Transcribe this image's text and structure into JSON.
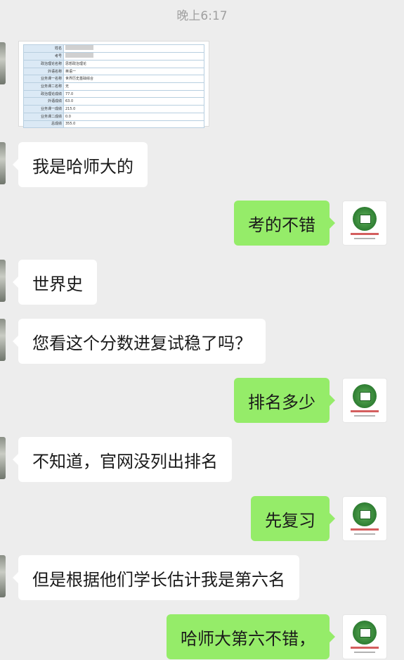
{
  "status": {
    "time": "晚上6:17"
  },
  "score_image": {
    "rows": [
      {
        "label": "姓名",
        "value": ""
      },
      {
        "label": "考号",
        "value": ""
      },
      {
        "label": "政治理论名称",
        "value": "思想政治理论"
      },
      {
        "label": "外语名称",
        "value": "英语一"
      },
      {
        "label": "业务课一名称",
        "value": "世界历史基础综合"
      },
      {
        "label": "业务课二名称",
        "value": "无"
      },
      {
        "label": "政治理论成绩",
        "value": "77.0"
      },
      {
        "label": "外语成绩",
        "value": "63.0"
      },
      {
        "label": "业务课一成绩",
        "value": "215.0"
      },
      {
        "label": "业务课二成绩",
        "value": "0.0"
      },
      {
        "label": "总成绩",
        "value": "355.0"
      }
    ]
  },
  "messages": [
    {
      "side": "in",
      "text": "我是哈师大的"
    },
    {
      "side": "out",
      "text": "考的不错"
    },
    {
      "side": "in",
      "text": "世界史"
    },
    {
      "side": "in",
      "text": "您看这个分数进复试稳了吗？"
    },
    {
      "side": "out",
      "text": "排名多少"
    },
    {
      "side": "in",
      "text": "不知道，官网没列出排名"
    },
    {
      "side": "out",
      "text": "先复习"
    },
    {
      "side": "in",
      "text": "但是根据他们学长估计我是第六名"
    },
    {
      "side": "out",
      "text": "哈师大第六不错，"
    }
  ]
}
